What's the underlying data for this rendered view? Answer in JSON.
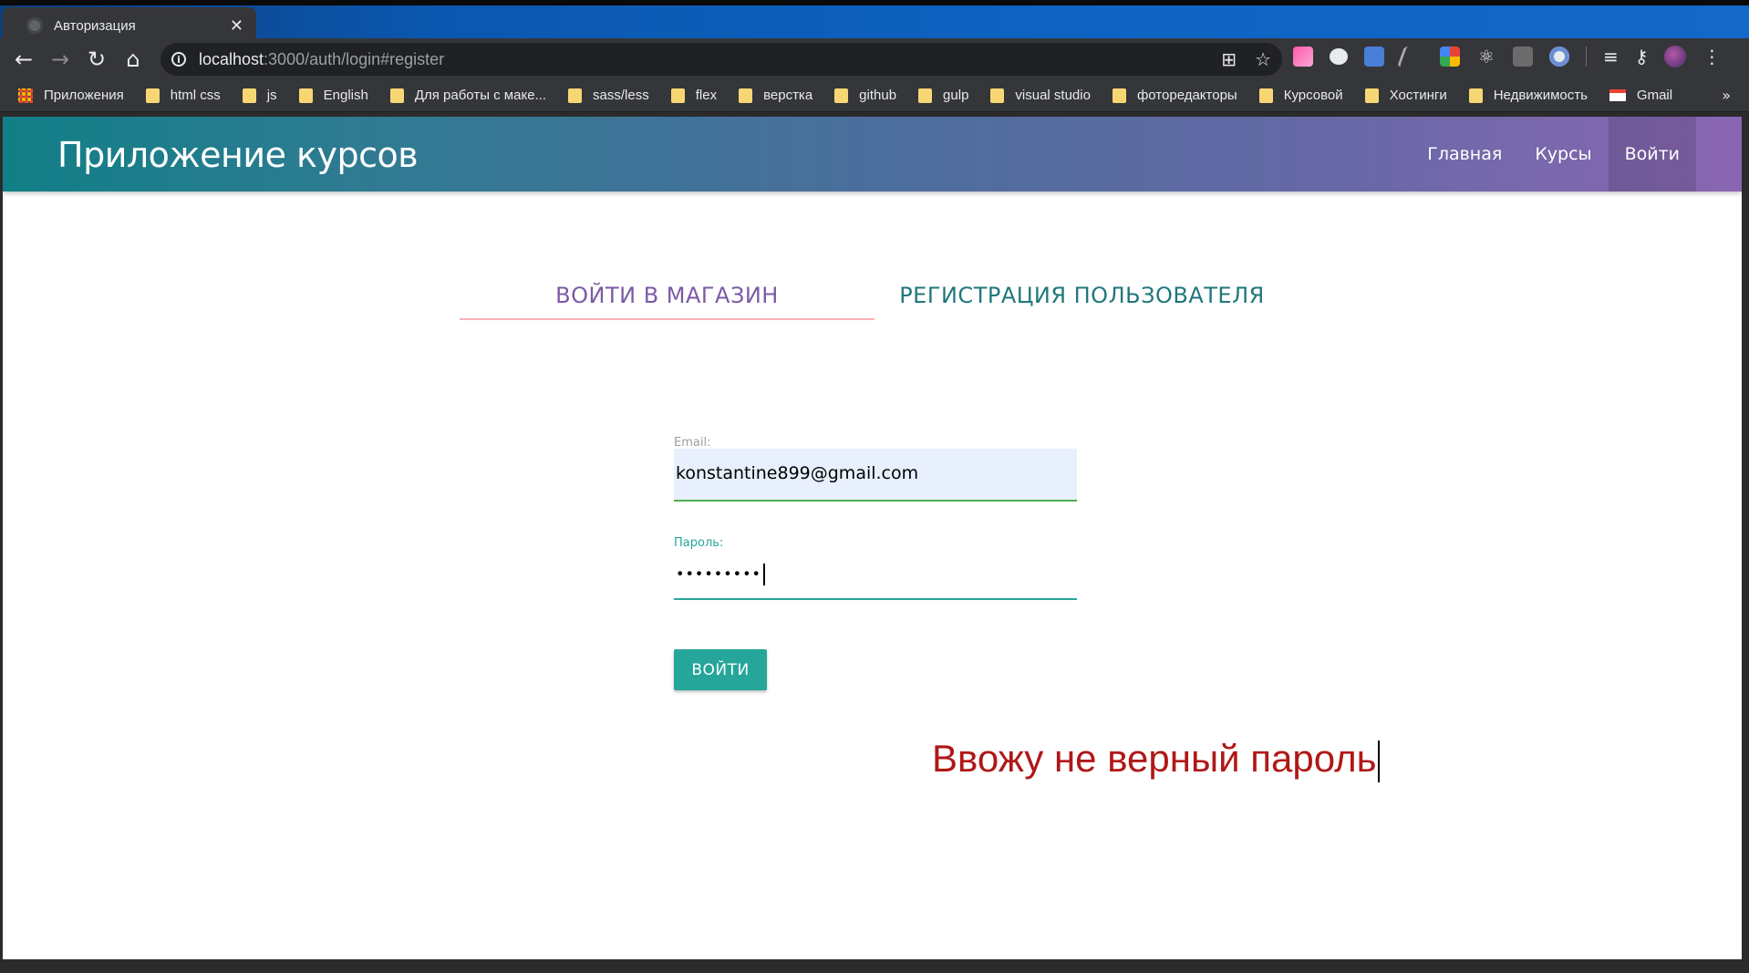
{
  "browser": {
    "tab_title": "Авторизация",
    "tab_close": "✕",
    "url_host": "localhost",
    "url_rest": ":3000/auth/login#register",
    "bookmarks": [
      {
        "label": "Приложения",
        "icon": "apps-icon"
      },
      {
        "label": "html css",
        "icon": "folder-icon"
      },
      {
        "label": "js",
        "icon": "folder-icon"
      },
      {
        "label": "English",
        "icon": "folder-icon"
      },
      {
        "label": "Для работы с маке...",
        "icon": "folder-icon"
      },
      {
        "label": "sass/less",
        "icon": "folder-icon"
      },
      {
        "label": "flex",
        "icon": "folder-icon"
      },
      {
        "label": "верстка",
        "icon": "folder-icon"
      },
      {
        "label": "github",
        "icon": "folder-icon"
      },
      {
        "label": "gulp",
        "icon": "folder-icon"
      },
      {
        "label": "visual studio",
        "icon": "folder-icon"
      },
      {
        "label": "фоторедакторы",
        "icon": "folder-icon"
      },
      {
        "label": "Курсовой",
        "icon": "folder-icon"
      },
      {
        "label": "Хостинги",
        "icon": "folder-icon"
      },
      {
        "label": "Недвижимость",
        "icon": "folder-icon"
      },
      {
        "label": "Gmail",
        "icon": "gmail-icon"
      }
    ],
    "bookmarks_more": "»"
  },
  "app": {
    "brand": "Приложение курсов",
    "nav": {
      "home": "Главная",
      "courses": "Курсы",
      "login": "Войти"
    }
  },
  "auth": {
    "tabs": {
      "login": "ВОЙТИ В МАГАЗИН",
      "register": "РЕГИСТРАЦИЯ ПОЛЬЗОВАТЕЛЯ"
    },
    "email_label": "Email:",
    "email_value": "konstantine899@gmail.com",
    "password_label": "Пароль:",
    "password_value": "•••••••••",
    "submit": "ВОЙТИ"
  },
  "annotation": "Ввожу не верный пароль",
  "colors": {
    "nav_gradient_start": "#117f86",
    "nav_gradient_end": "#8a66b2",
    "teal": "#26a69a",
    "login_tab": "#7b5aa6",
    "register_tab": "#20777b",
    "annotation": "#b01818"
  }
}
